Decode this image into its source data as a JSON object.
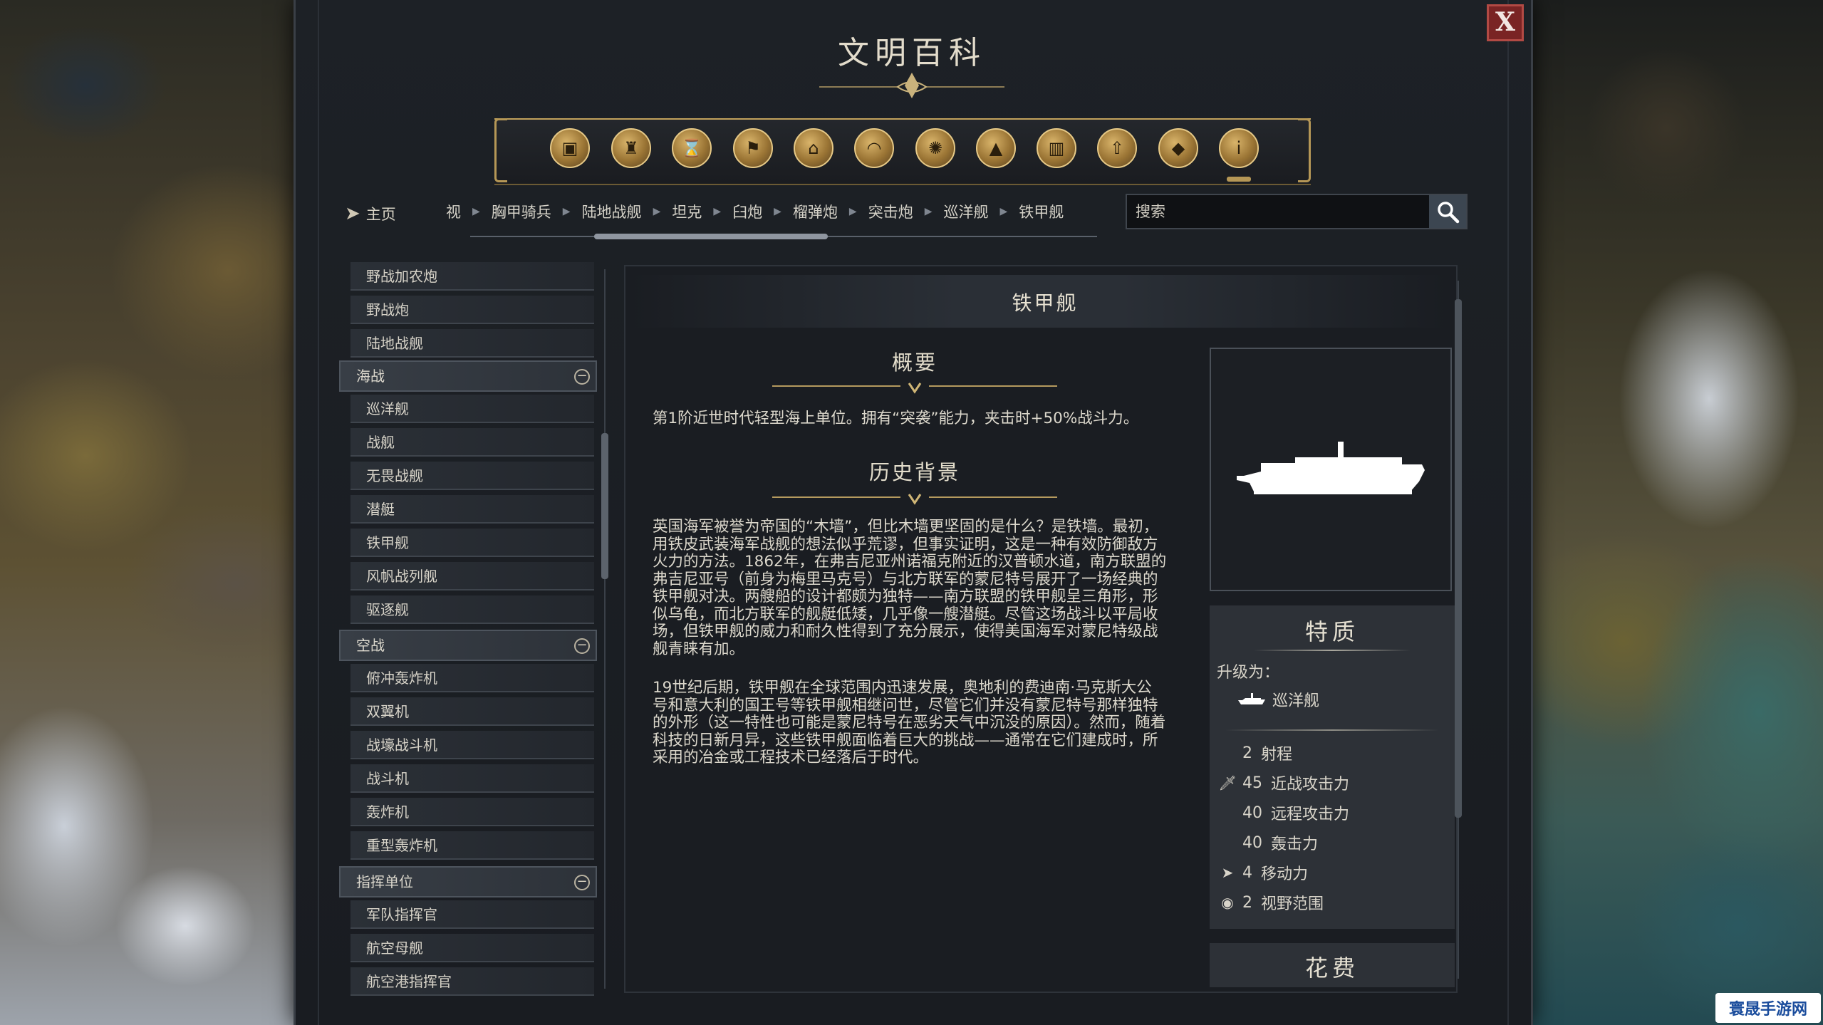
{
  "window": {
    "title": "文明百科",
    "close_label": "X"
  },
  "categories": [
    {
      "icon": "units-icon"
    },
    {
      "icon": "buildings-icon"
    },
    {
      "icon": "eras-icon"
    },
    {
      "icon": "civilizations-icon"
    },
    {
      "icon": "wonders-icon"
    },
    {
      "icon": "culture-icon"
    },
    {
      "icon": "science-icon"
    },
    {
      "icon": "terrain-icon"
    },
    {
      "icon": "city-icon"
    },
    {
      "icon": "upgrade-icon"
    },
    {
      "icon": "resources-icon"
    },
    {
      "icon": "info-icon"
    }
  ],
  "nav": {
    "home_label": "主页",
    "breadcrumbs": [
      "视",
      "胸甲骑兵",
      "陆地战舰",
      "坦克",
      "臼炮",
      "榴弹炮",
      "突击炮",
      "巡洋舰",
      "铁甲舰"
    ]
  },
  "search": {
    "placeholder": "搜索"
  },
  "list": {
    "items_top": [
      "野战加农炮",
      "野战炮",
      "陆地战舰"
    ],
    "group_naval": "海战",
    "naval": [
      "巡洋舰",
      "战舰",
      "无畏战舰",
      "潜艇",
      "铁甲舰",
      "风帆战列舰",
      "驱逐舰"
    ],
    "group_air": "空战",
    "air": [
      "俯冲轰炸机",
      "双翼机",
      "战壕战斗机",
      "战斗机",
      "轰炸机",
      "重型轰炸机"
    ],
    "group_command": "指挥单位",
    "command": [
      "军队指挥官",
      "航空母舰",
      "航空港指挥官"
    ]
  },
  "unit": {
    "name": "铁甲舰",
    "overview_title": "概要",
    "overview_text": "第1阶近世时代轻型海上单位。拥有“突袭”能力，夹击时+50%战斗力。",
    "history_title": "历史背景",
    "history_p1": "英国海军被誉为帝国的“木墙”，但比木墙更坚固的是什么？是铁墙。最初，用铁皮武装海军战舰的想法似乎荒谬，但事实证明，这是一种有效防御敌方火力的方法。1862年，在弗吉尼亚州诺福克附近的汉普顿水道，南方联盟的弗吉尼亚号（前身为梅里马克号）与北方联军的蒙尼特号展开了一场经典的铁甲舰对决。两艘船的设计都颇为独特——南方联盟的铁甲舰呈三角形，形似乌龟，而北方联军的舰艇低矮，几乎像一艘潜艇。尽管这场战斗以平局收场，但铁甲舰的威力和耐久性得到了充分展示，使得美国海军对蒙尼特级战舰青睐有加。",
    "history_p2": "19世纪后期，铁甲舰在全球范围内迅速发展，奥地利的费迪南·马克斯大公号和意大利的国王号等铁甲舰相继问世，尽管它们并没有蒙尼特号那样独特的外形（这一特性也可能是蒙尼特号在恶劣天气中沉没的原因）。然而，随着科技的日新月异，这些铁甲舰面临着巨大的挑战——通常在它们建成时，所采用的冶金或工程技术已经落后于时代。"
  },
  "traits": {
    "title": "特质",
    "upgrade_label": "升级为：",
    "upgrade_to": "巡洋舰",
    "stats": [
      {
        "icon": "",
        "value": "2",
        "label": "射程"
      },
      {
        "icon": "melee-icon",
        "value": "45",
        "label": "近战攻击力"
      },
      {
        "icon": "",
        "value": "40",
        "label": "远程攻击力"
      },
      {
        "icon": "",
        "value": "40",
        "label": "轰击力"
      },
      {
        "icon": "movement-icon",
        "value": "4",
        "label": "移动力"
      },
      {
        "icon": "sight-icon",
        "value": "2",
        "label": "视野范围"
      }
    ]
  },
  "cost": {
    "title": "花费"
  },
  "watermark": {
    "text": "寰晟手游网"
  }
}
